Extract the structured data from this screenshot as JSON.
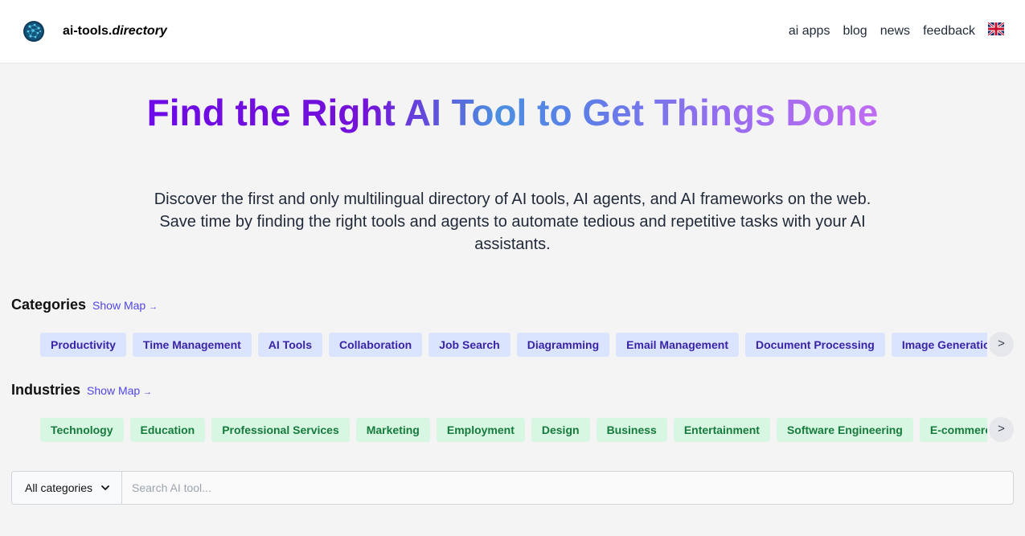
{
  "header": {
    "logo_icon": "globe-network-icon",
    "brand_prefix": "ai-tools.",
    "brand_suffix": "directory",
    "nav": [
      "ai apps",
      "blog",
      "news",
      "feedback"
    ],
    "language_icon": "uk-flag-icon"
  },
  "hero": {
    "title": "Find the Right AI Tool to Get Things Done",
    "subtitle": "Discover the first and only multilingual directory of AI tools, AI agents, and AI frameworks on the web. Save time by finding the right tools and agents to automate tedious and repetitive tasks with your AI assistants."
  },
  "categories": {
    "heading": "Categories",
    "map_link": "Show Map",
    "arrow": "→",
    "items": [
      "Productivity",
      "Time Management",
      "AI Tools",
      "Collaboration",
      "Job Search",
      "Diagramming",
      "Email Management",
      "Document Processing",
      "Image Generation"
    ],
    "scroll": ">"
  },
  "industries": {
    "heading": "Industries",
    "map_link": "Show Map",
    "arrow": "→",
    "items": [
      "Technology",
      "Education",
      "Professional Services",
      "Marketing",
      "Employment",
      "Design",
      "Business",
      "Entertainment",
      "Software Engineering",
      "E-commerce"
    ],
    "scroll": ">"
  },
  "search": {
    "category_select": "All categories",
    "placeholder": "Search AI tool..."
  },
  "colors": {
    "category_chip_bg": "#dbe4fe",
    "category_chip_text": "#3923a8",
    "industry_chip_bg": "#d8f7e2",
    "industry_chip_text": "#157a3c",
    "link": "#4f46e5"
  }
}
